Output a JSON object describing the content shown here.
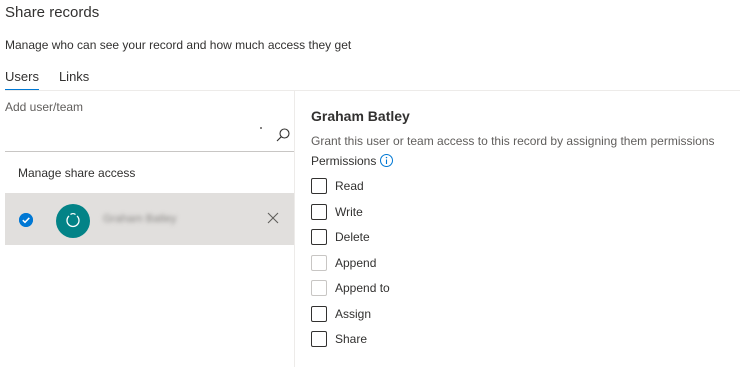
{
  "dialog": {
    "title": "Share records",
    "subtitle": "Manage who can see your record and how much access they get"
  },
  "tabs": [
    {
      "label": "Users",
      "active": true
    },
    {
      "label": "Links",
      "active": false
    }
  ],
  "left_panel": {
    "add_label": "Add user/team",
    "search_value": "",
    "manage_label": "Manage share access",
    "selected_user": {
      "name": "Graham Batley",
      "selected": true,
      "avatar_color": "#038387"
    }
  },
  "right_panel": {
    "user_title": "Graham Batley",
    "grant_text": "Grant this user or team access to this record by assigning them permissions",
    "permissions_label": "Permissions",
    "permissions": [
      {
        "label": "Read",
        "checked": false,
        "disabled": false
      },
      {
        "label": "Write",
        "checked": false,
        "disabled": false
      },
      {
        "label": "Delete",
        "checked": false,
        "disabled": false
      },
      {
        "label": "Append",
        "checked": false,
        "disabled": true
      },
      {
        "label": "Append to",
        "checked": false,
        "disabled": true
      },
      {
        "label": "Assign",
        "checked": false,
        "disabled": false
      },
      {
        "label": "Share",
        "checked": false,
        "disabled": false
      }
    ]
  },
  "colors": {
    "accent": "#0078d4",
    "selected_row_bg": "#e1dfdd",
    "avatar": "#038387"
  },
  "icons": {
    "search": "search-icon",
    "remove": "close-icon",
    "info": "info-icon",
    "selected": "checkmark-circle-icon",
    "avatar": "team-icon"
  }
}
